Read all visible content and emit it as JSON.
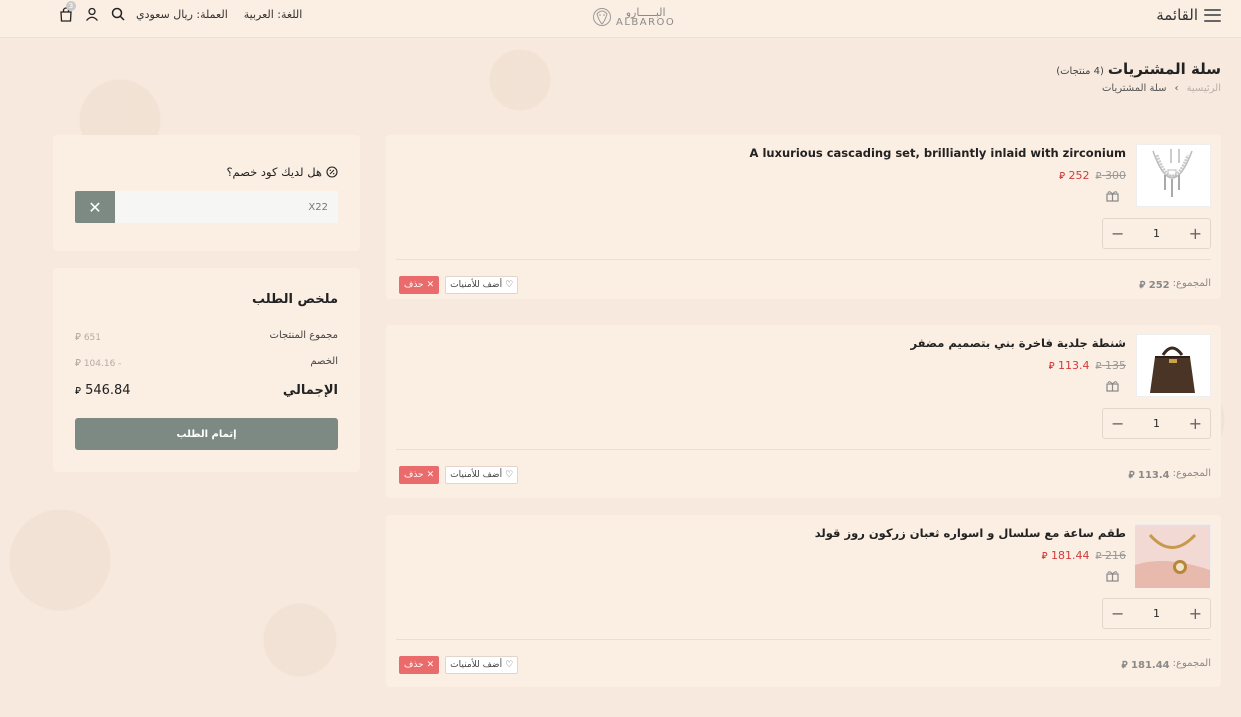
{
  "header": {
    "menu_label": "القائمة",
    "logo_ar": "البـــــارو",
    "logo_en": "ALBAROO",
    "language_label": "اللغة: العربية",
    "currency_label": "العملة: ريال سعودي",
    "cart_count": "3"
  },
  "page": {
    "title": "سلة المشتريات",
    "count": "(4 منتجات)",
    "breadcrumb_home": "الرئيسية",
    "breadcrumb_sep": "›",
    "breadcrumb_current": "سلة المشتريات"
  },
  "currency_symbol": "⃁",
  "items": [
    {
      "name": "A luxurious cascading set, brilliantly inlaid with zirconium",
      "old_price": "300",
      "new_price": "252",
      "qty": "1",
      "total_label": "المجموع:",
      "total": "252",
      "wishlist_label": "أضف للأمنيات",
      "delete_label": "حذف"
    },
    {
      "name": "شنطة جلدية فاخرة بني بتصميم مضفر",
      "old_price": "135",
      "new_price": "113.4",
      "qty": "1",
      "total_label": "المجموع:",
      "total": "113.4",
      "wishlist_label": "أضف للأمنيات",
      "delete_label": "حذف"
    },
    {
      "name": "طقم ساعة مع سلسال و اسواره ثعبان زركون روز قولد",
      "old_price": "216",
      "new_price": "181.44",
      "qty": "1",
      "total_label": "المجموع:",
      "total": "181.44",
      "wishlist_label": "أضف للأمنيات",
      "delete_label": "حذف"
    }
  ],
  "coupon": {
    "question": "هل لديك كود خصم؟",
    "value": "X22"
  },
  "summary": {
    "title": "ملخص الطلب",
    "subtotal_label": "مجموع المنتجات",
    "subtotal": "651",
    "discount_label": "الخصم",
    "discount": "104.16 -",
    "total_label": "الإجمالي",
    "total": "546.84",
    "checkout_label": "إتمام الطلب"
  },
  "colors": {
    "background": "#f7e9dd",
    "card": "#fbeee3",
    "accent": "#7d8a84",
    "sale": "#d13b3b",
    "delete": "#ea6b6b"
  }
}
